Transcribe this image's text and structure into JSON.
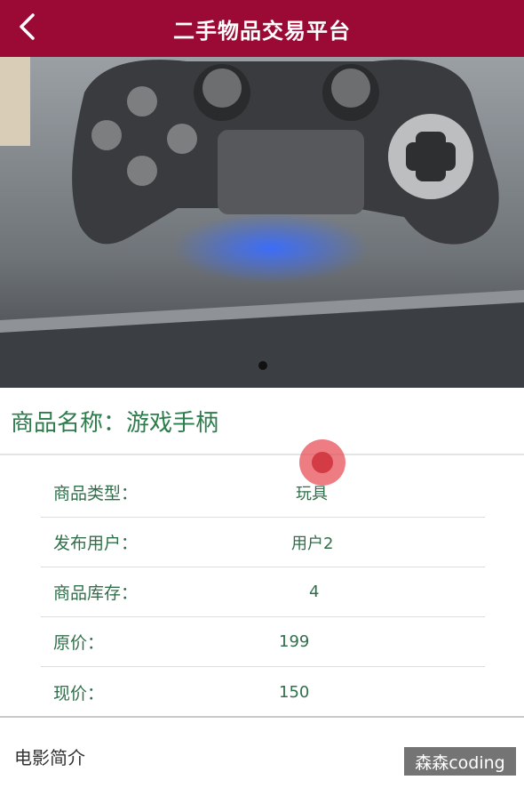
{
  "header": {
    "title": "二手物品交易平台",
    "back_icon": "chevron-left-icon",
    "background_color": "#9b0a35"
  },
  "carousel": {
    "image_subject": "game-controller-photo",
    "active_index": 1,
    "total": 1
  },
  "product": {
    "name_label": "商品名称：",
    "name_value": "游戏手柄"
  },
  "specs": [
    {
      "label": "商品类型：",
      "value": "玩具"
    },
    {
      "label": "发布用户：",
      "value": "用户2"
    },
    {
      "label": "商品库存：",
      "value": "4"
    },
    {
      "label": "原价：",
      "value": "199"
    },
    {
      "label": "现价：",
      "value": "150"
    }
  ],
  "intro": {
    "label": "电影简介"
  },
  "watermark": {
    "text": "森森coding"
  },
  "colors": {
    "accent": "#9b0a35",
    "text_green": "#2d7d4c"
  }
}
